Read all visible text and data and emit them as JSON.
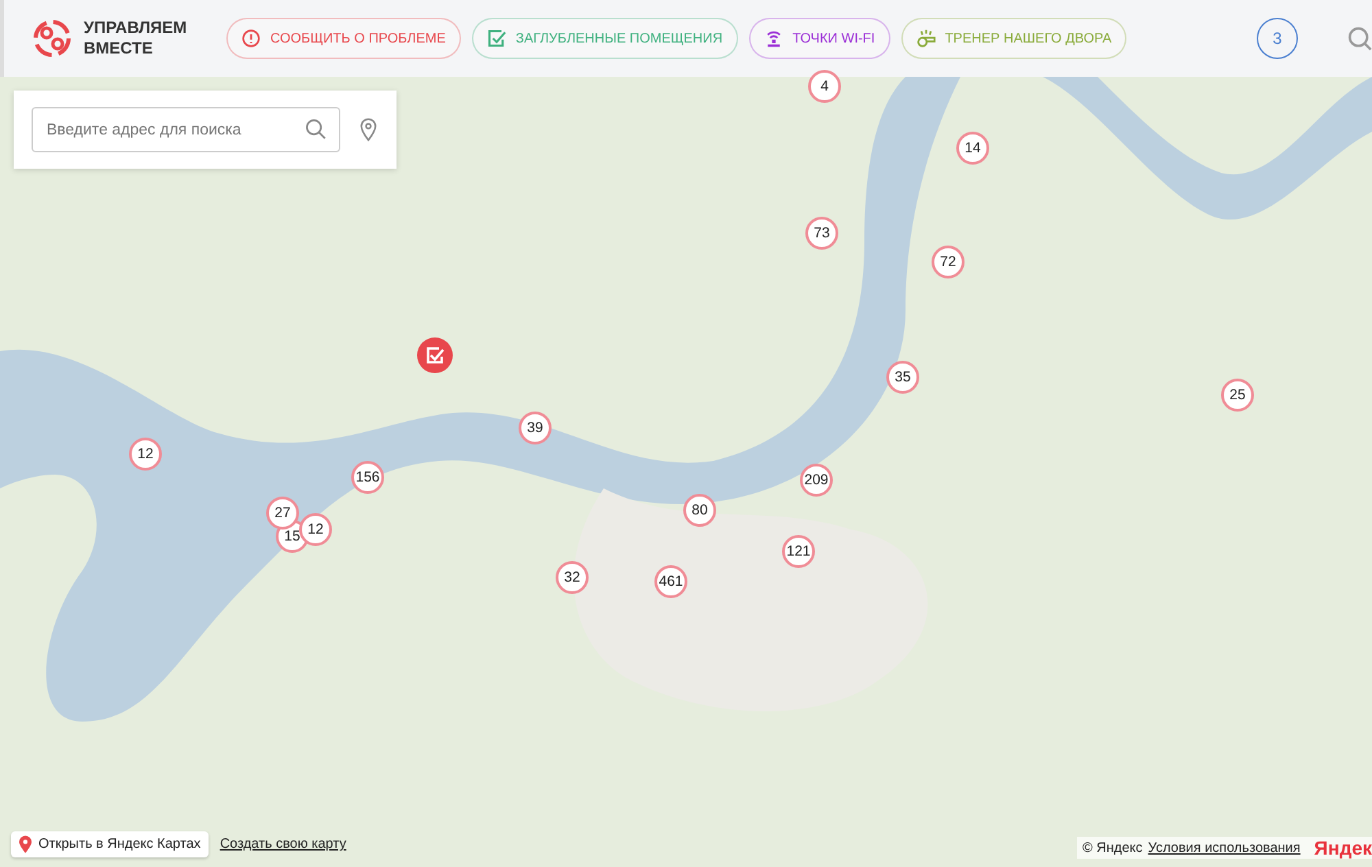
{
  "header": {
    "logo_text": "УПРАВЛЯЕМ ВМЕСТЕ",
    "buttons": [
      {
        "kind": "alert",
        "label": "СООБЩИТЬ О ПРОБЛЕМЕ",
        "color": "#e8474c"
      },
      {
        "kind": "check",
        "label": "ЗАГЛУБЛЕННЫЕ ПОМЕЩЕНИЯ",
        "color": "#3fb17f"
      },
      {
        "kind": "wifi",
        "label": "ТОЧКИ WI-FI",
        "color": "#9b2fd6"
      },
      {
        "kind": "whistle",
        "label": "ТРЕНЕР НАШЕГО ДВОРА",
        "color": "#8aab3a"
      }
    ],
    "counter": "3"
  },
  "search": {
    "placeholder": "Введите адрес для поиска"
  },
  "markers": [
    {
      "kind": "problem"
    },
    {
      "kind": "cluster",
      "count": "4"
    },
    {
      "kind": "cluster",
      "count": "14"
    },
    {
      "kind": "cluster",
      "count": "73"
    },
    {
      "kind": "cluster",
      "count": "72"
    },
    {
      "kind": "cluster",
      "count": "35"
    },
    {
      "kind": "cluster",
      "count": "25"
    },
    {
      "kind": "cluster",
      "count": "39"
    },
    {
      "kind": "cluster",
      "count": "12"
    },
    {
      "kind": "cluster",
      "count": "156"
    },
    {
      "kind": "cluster",
      "count": "209"
    },
    {
      "kind": "cluster",
      "count": "15"
    },
    {
      "kind": "cluster",
      "count": "27"
    },
    {
      "kind": "cluster",
      "count": "12"
    },
    {
      "kind": "cluster",
      "count": "80"
    },
    {
      "kind": "cluster",
      "count": "121"
    },
    {
      "kind": "cluster",
      "count": "32"
    },
    {
      "kind": "cluster",
      "count": "461"
    }
  ],
  "footer": {
    "open_link": "Открыть в Яндекс Картах",
    "create_link": "Создать свою карту",
    "copyright": "© Яндекс",
    "terms_link": "Условия использования",
    "brand": "Яндек"
  }
}
